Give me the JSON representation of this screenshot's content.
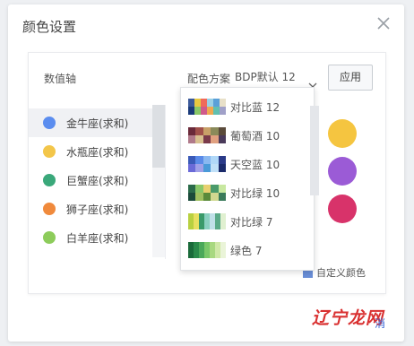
{
  "dialog": {
    "title": "颜色设置",
    "axis_label": "数值轴",
    "scheme_label": "配色方案",
    "scheme_selected": "BDP默认 12",
    "apply_label": "应用",
    "custom_color_label": "自定义颜色",
    "close_icon": "close-icon"
  },
  "axis_items": [
    {
      "label": "金牛座(求和)",
      "color": "#5b8def",
      "active": true
    },
    {
      "label": "水瓶座(求和)",
      "color": "#f3c64a",
      "active": false
    },
    {
      "label": "巨蟹座(求和)",
      "color": "#3aa87a",
      "active": false
    },
    {
      "label": "狮子座(求和)",
      "color": "#f08a3c",
      "active": false
    },
    {
      "label": "白羊座(求和)",
      "color": "#8dcc5b",
      "active": false
    }
  ],
  "preview_colors": [
    "#f5c540",
    "#9b5bd6",
    "#d8336a"
  ],
  "schemes": [
    {
      "name": "对比蓝 12",
      "swatch": [
        "#3c5a9a",
        "#e8c840",
        "#f06a5a",
        "#9ad0e6",
        "#5aa0d8",
        "#e8e0c8",
        "#1a3a7a",
        "#8ac868",
        "#d05a8a",
        "#f0a850",
        "#60c0b0",
        "#a0a0c8"
      ]
    },
    {
      "name": "葡萄酒 10",
      "swatch": [
        "#6a2a3a",
        "#a0504a",
        "#c8a068",
        "#8a8a5a",
        "#5a4a3a",
        "#b07a8a",
        "#d8c090",
        "#7a3a4a",
        "#e0a080",
        "#4a3a5a"
      ]
    },
    {
      "name": "天空蓝 10",
      "swatch": [
        "#3a5ab8",
        "#5a8ae8",
        "#8ab8f0",
        "#b0d8f8",
        "#2a3a88",
        "#6a6ad8",
        "#a0a0e8",
        "#4a9ad8",
        "#c0e0f8",
        "#1a2a6a"
      ]
    },
    {
      "name": "对比绿 10",
      "swatch": [
        "#2a6a4a",
        "#8ac86a",
        "#e8d070",
        "#4a9a6a",
        "#c8e8a0",
        "#1a4a3a",
        "#a0c060",
        "#5a8a3a",
        "#d0d890",
        "#3a7a5a"
      ]
    },
    {
      "name": "对比绿 7",
      "swatch": [
        "#b8d040",
        "#e8e060",
        "#3a9a6a",
        "#8ad0c0",
        "#c0e0e8",
        "#5aaa88",
        "#e0f0d0"
      ]
    },
    {
      "name": "绿色 7",
      "swatch": [
        "#1a6a3a",
        "#2a8a4a",
        "#4aa85a",
        "#7ac86a",
        "#a8d880",
        "#d0e8a8",
        "#eaf4d8"
      ]
    }
  ],
  "watermark": {
    "text": "辽宁龙网",
    "tail": "消"
  }
}
